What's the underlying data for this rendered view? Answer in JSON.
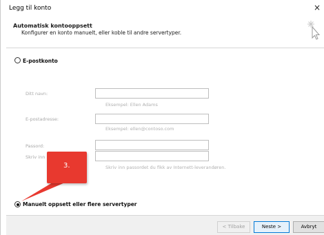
{
  "window": {
    "title": "Legg til konto",
    "close_glyph": "×"
  },
  "header": {
    "title": "Automatisk kontooppsett",
    "subtitle": "Konfigurer en konto manuelt, eller koble til andre servertyper."
  },
  "options": {
    "email_account": {
      "label": "E-postkonto",
      "selected": false
    },
    "manual_setup": {
      "label": "Manuelt oppsett eller flere servertyper",
      "selected": true
    }
  },
  "fields": [
    {
      "label": "Ditt navn:",
      "value": "",
      "hint": "Eksempel: Ellen Adams"
    },
    {
      "label": "E-postadresse:",
      "value": "",
      "hint": "Eksempel: ellen@contoso.com"
    },
    {
      "label": "Passord:",
      "value": "",
      "hint": ""
    },
    {
      "label": "Skriv inn",
      "value": "",
      "hint": "Skriv inn passordet du fikk av Internett-leverandøren."
    }
  ],
  "callout": {
    "text": "3.",
    "color": "#e8392f"
  },
  "buttons": {
    "back": "< Tilbake",
    "next": "Neste >",
    "cancel": "Avbryt"
  },
  "colors": {
    "accent": "#0078d7",
    "callout": "#e8392f",
    "footer_bg": "#f0f0f0"
  }
}
